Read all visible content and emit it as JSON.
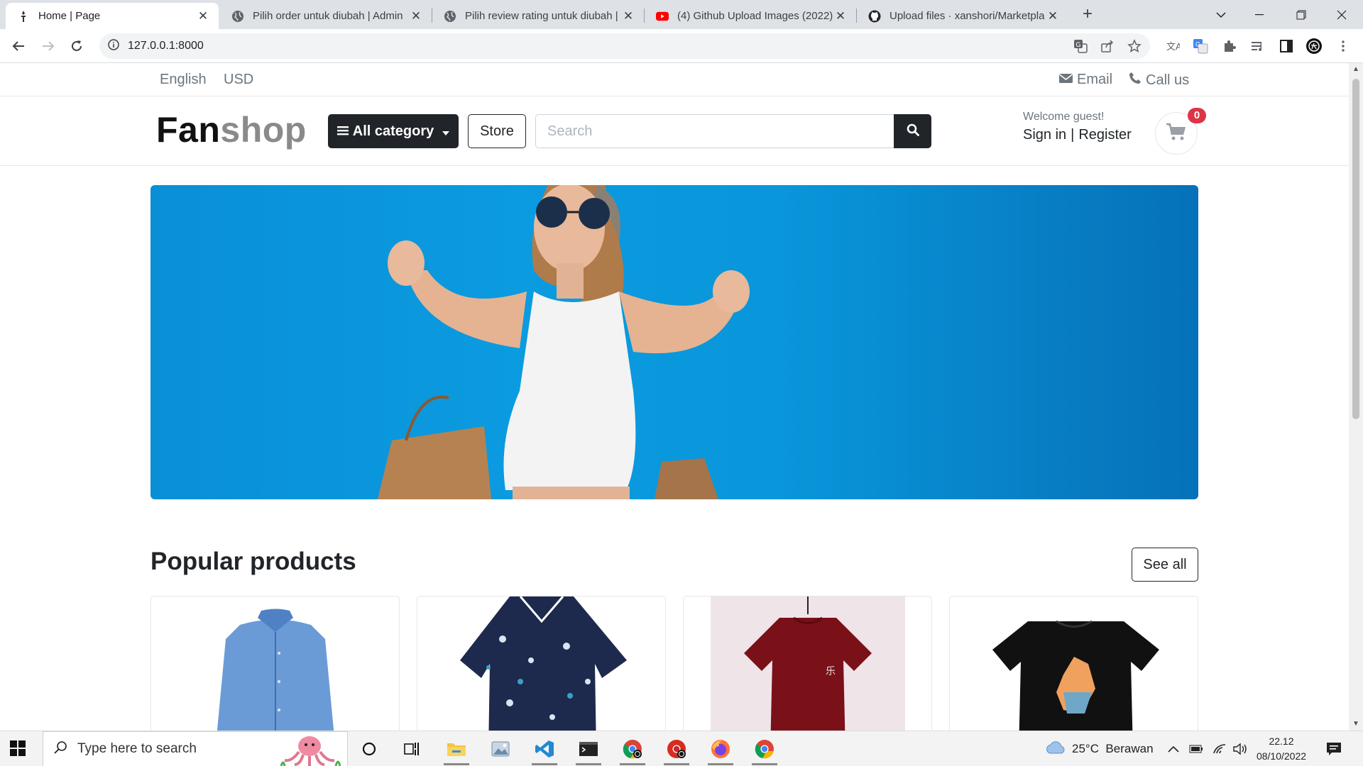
{
  "browser": {
    "tabs": [
      {
        "title": "Home | Page",
        "active": true
      },
      {
        "title": "Pilih order untuk diubah | Admin",
        "active": false
      },
      {
        "title": "Pilih review rating untuk diubah |",
        "active": false
      },
      {
        "title": "(4) Github Upload Images (2022)",
        "active": false
      },
      {
        "title": "Upload files · xanshori/Marketpla",
        "active": false
      }
    ],
    "url": "127.0.0.1:8000"
  },
  "topnav": {
    "language": "English",
    "currency": "USD",
    "email_label": "Email",
    "call_label": "Call us"
  },
  "header": {
    "logo_part1": "Fan",
    "logo_part2": "shop",
    "category_button": "All category",
    "store_button": "Store",
    "search_placeholder": "Search",
    "welcome": "Welcome guest!",
    "sign_in": "Sign in",
    "separator": "|",
    "register": "Register",
    "cart_count": "0"
  },
  "main": {
    "section_title": "Popular products",
    "see_all": "See all",
    "products": [
      {
        "image": "blue-dress-shirt"
      },
      {
        "image": "navy-hawaiian-shirt"
      },
      {
        "image": "maroon-tshirt"
      },
      {
        "image": "black-tshirt"
      }
    ]
  },
  "taskbar": {
    "search_placeholder": "Type here to search",
    "weather": "25°C  Berawan",
    "time": "22.12",
    "date": "08/10/2022"
  },
  "colors": {
    "dark": "#212529",
    "muted": "#6c757d",
    "badge": "#dc3545",
    "banner_blue": "#0a8fd6"
  }
}
